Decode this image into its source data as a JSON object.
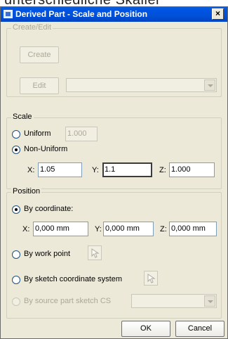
{
  "top_text": "unterschiedliche Skalier",
  "window": {
    "title": "Derived Part - Scale and Position",
    "close_glyph": "×"
  },
  "create_edit": {
    "group_label": "Create/Edit",
    "create_label": "Create",
    "edit_label": "Edit",
    "edit_combo_value": ""
  },
  "scale": {
    "group_label": "Scale",
    "uniform_label": "Uniform",
    "uniform_value": "1.000",
    "nonuniform_label": "Non-Uniform",
    "selected": "Non-Uniform",
    "x_label": "X:",
    "x_value": "1.05",
    "y_label": "Y:",
    "y_value": "1.1",
    "z_label": "Z:",
    "z_value": "1.000"
  },
  "position": {
    "group_label": "Position",
    "selected": "By coordinate:",
    "by_coordinate_label": "By coordinate:",
    "x_label": "X:",
    "x_value": "0,000 mm",
    "y_label": "Y:",
    "y_value": "0,000 mm",
    "z_label": "Z:",
    "z_value": "0,000 mm",
    "by_work_point_label": "By work point",
    "by_sketch_cs_label": "By sketch coordinate system",
    "by_source_sketch_label": "By source part sketch CS",
    "source_sketch_combo_value": ""
  },
  "footer": {
    "ok_label": "OK",
    "cancel_label": "Cancel"
  },
  "icons": {
    "window_icon": "inventor-part-icon",
    "select_icon": "select-arrow-icon",
    "dropdown_icon": "chevron-down-icon"
  }
}
